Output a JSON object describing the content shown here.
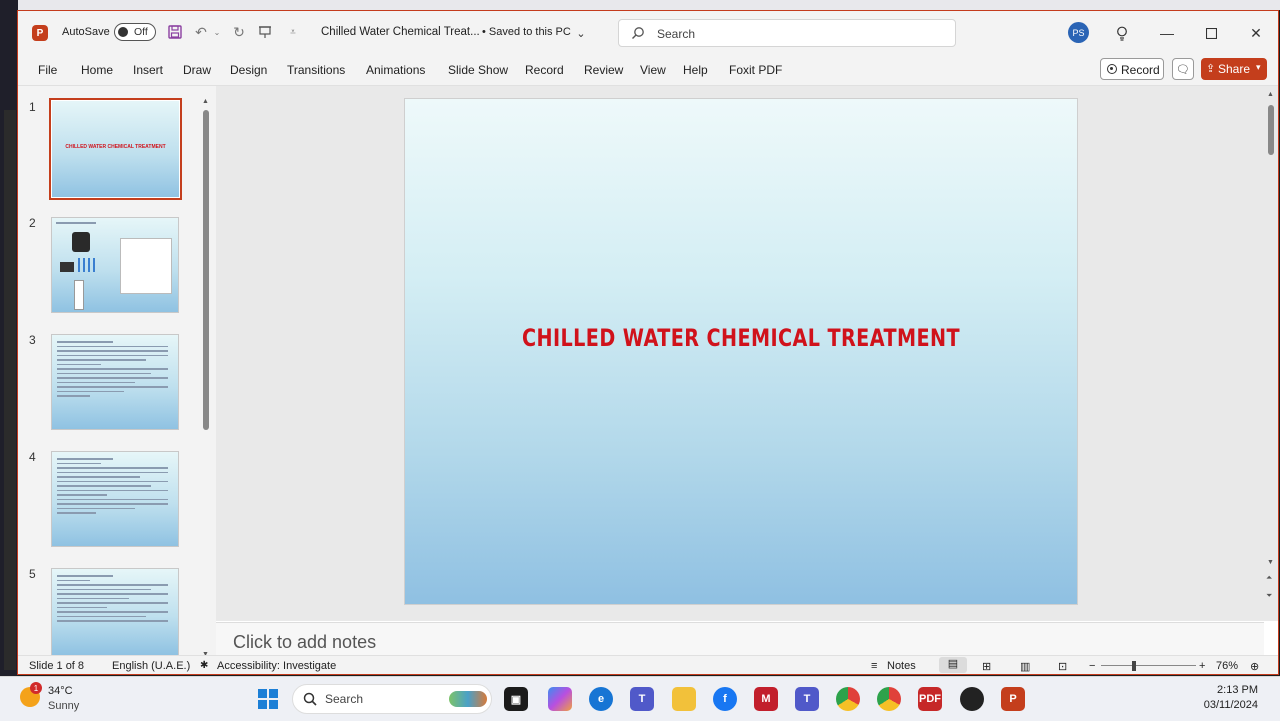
{
  "titlebar": {
    "app_logo": "P",
    "autosave_label": "AutoSave",
    "autosave_state": "Off",
    "document_title": "Chilled Water Chemical Treat...",
    "saved_status": "• Saved to this PC",
    "search_placeholder": "Search",
    "avatar_initials": "PS"
  },
  "ribbon": {
    "tabs": [
      "File",
      "Home",
      "Insert",
      "Draw",
      "Design",
      "Transitions",
      "Animations",
      "Slide Show",
      "Record",
      "Review",
      "View",
      "Help",
      "Foxit PDF"
    ],
    "record_label": "Record",
    "share_label": "Share"
  },
  "slides_panel": {
    "numbers": [
      "1",
      "2",
      "3",
      "4",
      "5"
    ],
    "thumb1_title": "CHILLED WATER CHEMICAL TREATMENT"
  },
  "slide": {
    "title": "CHILLED WATER CHEMICAL TREATMENT"
  },
  "notes": {
    "placeholder": "Click to add notes"
  },
  "status": {
    "slide_counter": "Slide 1 of 8",
    "language": "English (U.A.E.)",
    "accessibility": "Accessibility: Investigate",
    "notes_label": "Notes",
    "zoom": "76%"
  },
  "taskbar": {
    "temperature": "34°C",
    "condition": "Sunny",
    "weather_badge": "1",
    "search_label": "Search",
    "time": "2:13 PM",
    "date": "03/11/2024"
  },
  "colors": {
    "accent": "#c43e1c",
    "slide_title": "#d0121b"
  }
}
